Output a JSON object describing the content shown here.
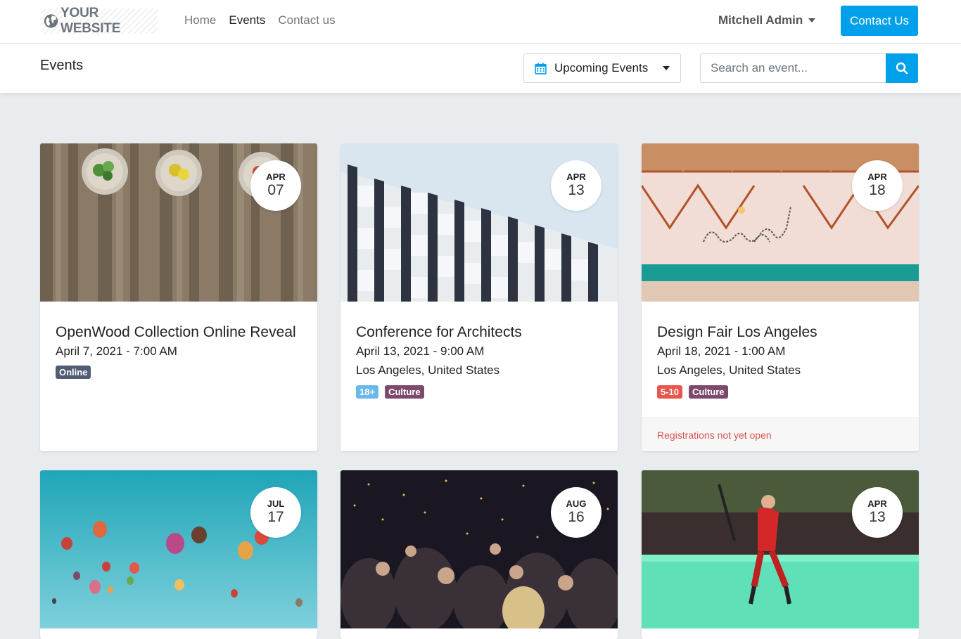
{
  "nav": {
    "brand": "YOUR WEBSITE",
    "links": [
      "Home",
      "Events",
      "Contact us"
    ],
    "active_link": "Events",
    "user": "Mitchell Admin",
    "cta": "Contact Us"
  },
  "subheader": {
    "title": "Events",
    "filter_label": "Upcoming Events",
    "search_placeholder": "Search an event..."
  },
  "events": [
    {
      "month": "APR",
      "day": "07",
      "title": "OpenWood Collection Online Reveal",
      "when": "April 7, 2021 - 7:00 AM",
      "where": "",
      "tags": [
        {
          "label": "Online",
          "color": "#4f5d75"
        }
      ],
      "footer": ""
    },
    {
      "month": "APR",
      "day": "13",
      "title": "Conference for Architects",
      "when": "April 13, 2021 - 9:00 AM",
      "where": "Los Angeles, United States",
      "tags": [
        {
          "label": "18+",
          "color": "#6ab8e8"
        },
        {
          "label": "Culture",
          "color": "#7d4a6b"
        }
      ],
      "footer": ""
    },
    {
      "month": "APR",
      "day": "18",
      "title": "Design Fair Los Angeles",
      "when": "April 18, 2021 - 1:00 AM",
      "where": "Los Angeles, United States",
      "tags": [
        {
          "label": "5-10",
          "color": "#e8574c"
        },
        {
          "label": "Culture",
          "color": "#7d4a6b"
        }
      ],
      "footer": "Registrations not yet open"
    },
    {
      "month": "JUL",
      "day": "17",
      "title": "",
      "when": "",
      "where": "",
      "tags": [],
      "footer": ""
    },
    {
      "month": "AUG",
      "day": "16",
      "title": "",
      "when": "",
      "where": "",
      "tags": [],
      "footer": ""
    },
    {
      "month": "APR",
      "day": "13",
      "title": "",
      "when": "",
      "where": "",
      "tags": [],
      "footer": ""
    }
  ],
  "colors": {
    "accent": "#00a0ea",
    "background": "#e9ecef",
    "registration_warning": "#d9534f"
  }
}
